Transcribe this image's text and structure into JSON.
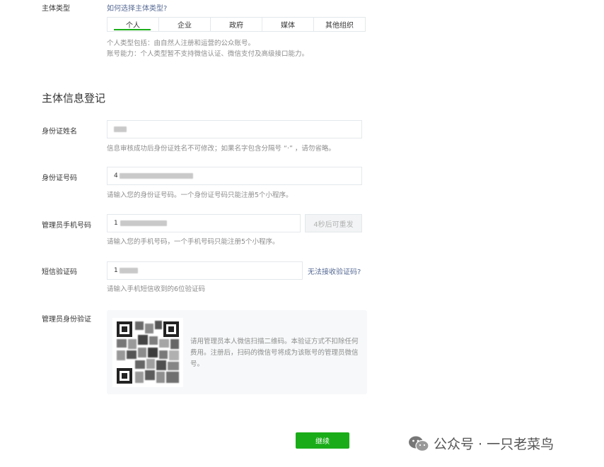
{
  "subject_type": {
    "label": "主体类型",
    "help_link": "如何选择主体类型?",
    "options": [
      "个人",
      "企业",
      "政府",
      "媒体",
      "其他组织"
    ],
    "desc_line1": "个人类型包括：由自然人注册和运营的公众账号。",
    "desc_line2": "账号能力：个人类型暂不支持微信认证、微信支付及高级接口能力。"
  },
  "section": {
    "title": "主体信息登记"
  },
  "id_name": {
    "label": "身份证姓名",
    "hint": "信息审核成功后身份证姓名不可修改；如果名字包含分隔号 “·” ，请勿省略。"
  },
  "id_number": {
    "label": "身份证号码",
    "value_prefix": "4",
    "hint": "请输入您的身份证号码。一个身份证号码只能注册5个小程序。"
  },
  "phone": {
    "label": "管理员手机号码",
    "value_prefix": "1",
    "resend_label": "4秒后可重发",
    "hint": "请输入您的手机号码，一个手机号码只能注册5个小程序。"
  },
  "sms_code": {
    "label": "短信验证码",
    "value_prefix": "1",
    "cannot_receive_link": "无法接收验证码?",
    "hint": "请输入手机短信收到的6位验证码"
  },
  "admin_verify": {
    "label": "管理员身份验证",
    "instruction": "请用管理员本人微信扫描二维码。本验证方式不扣除任何费用。注册后，扫码的微信号将成为该账号的管理员微信号。"
  },
  "submit": {
    "label": "继续"
  },
  "watermark": {
    "text": "公众号 · 一只老菜鸟"
  }
}
